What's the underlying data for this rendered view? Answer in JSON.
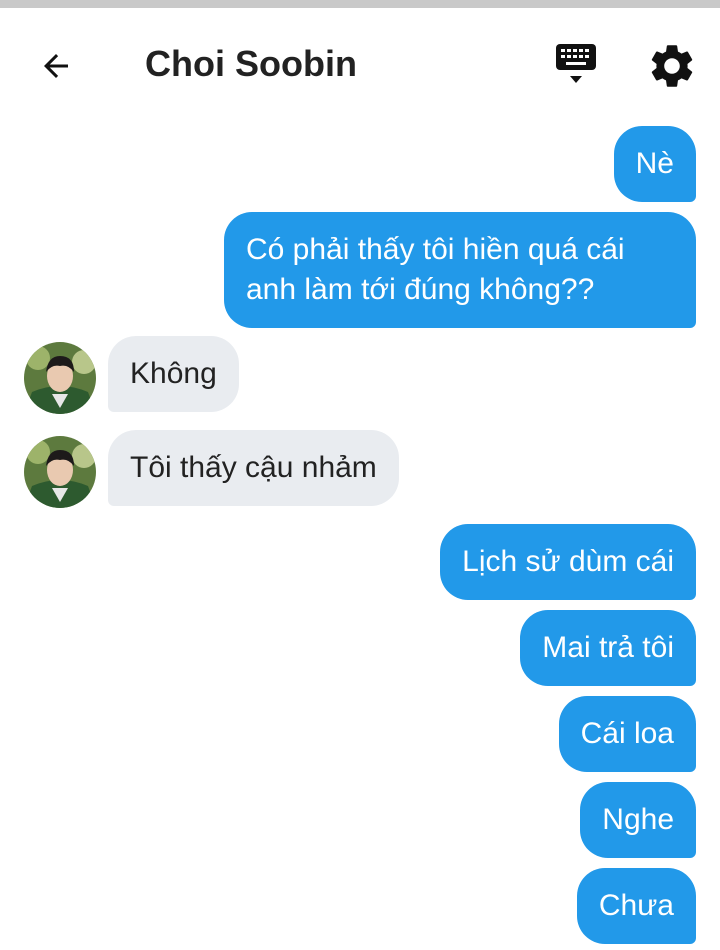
{
  "header": {
    "title": "Choi Soobin",
    "icons": [
      "back-arrow-icon",
      "keyboard-icon",
      "settings-gear-icon"
    ]
  },
  "colors": {
    "outgoing_bubble": "#2299e9",
    "incoming_bubble": "#e9ecf0",
    "outgoing_text": "#ffffff",
    "incoming_text": "#222222"
  },
  "messages": [
    {
      "side": "out",
      "text": "Nè"
    },
    {
      "side": "out",
      "text": "Có phải thấy tôi hiền quá cái anh làm tới đúng không??"
    },
    {
      "side": "in",
      "text": "Không"
    },
    {
      "side": "in",
      "text": "Tôi thấy cậu nhảm"
    },
    {
      "side": "out",
      "text": "Lịch sử dùm cái"
    },
    {
      "side": "out",
      "text": "Mai trả tôi"
    },
    {
      "side": "out",
      "text": "Cái loa"
    },
    {
      "side": "out",
      "text": "Nghe"
    },
    {
      "side": "out",
      "text": "Chưa"
    }
  ]
}
